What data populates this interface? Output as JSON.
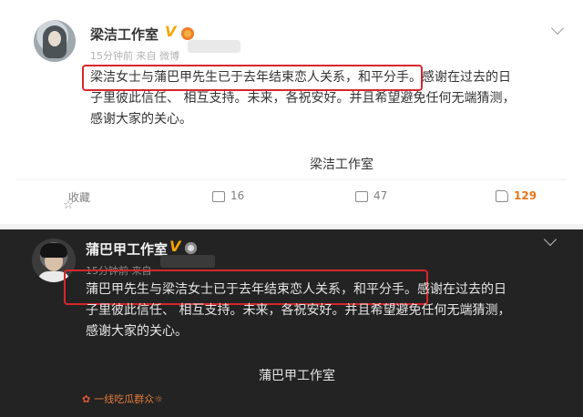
{
  "post_light": {
    "author": "梁洁工作室",
    "verified_badge": "V",
    "meta": "15分钟前 来自 微博",
    "content_highlight": "梁洁女士与蒲巴甲先生已于去年结束恋人关系，和平分手。",
    "content_rest": "感谢在过去的日子里彼此信任、 相互支持。未来，各祝安好。并且希望避免任何无端猜测，感谢大家的关心。",
    "signature": "梁洁工作室",
    "actions": {
      "favorite_label": "收藏",
      "repost_count": "16",
      "comment_count": "47",
      "like_count": "129"
    }
  },
  "post_dark": {
    "author": "蒲巴甲工作室",
    "verified_badge": "V",
    "meta": "15分钟前 来自",
    "content_highlight": "蒲巴甲先生与梁洁女士已于去年结束恋人关系，和平分手。",
    "content_rest": "感谢在过去的日子里彼此信任、 相互支持。未来，各祝安好。并且希望避免任何无端猜测，感谢大家的关心。",
    "signature": "蒲巴甲工作室",
    "watermark": "一线吃瓜群众"
  },
  "colors": {
    "highlight_border": "#d8262b",
    "verified": "#f7a400",
    "like_count": "#e8741a",
    "dark_background": "#232323"
  },
  "icons": [
    "star-icon",
    "repost-icon",
    "comment-icon",
    "like-icon",
    "chevron-down-icon",
    "medal-icon",
    "flower-icon"
  ]
}
